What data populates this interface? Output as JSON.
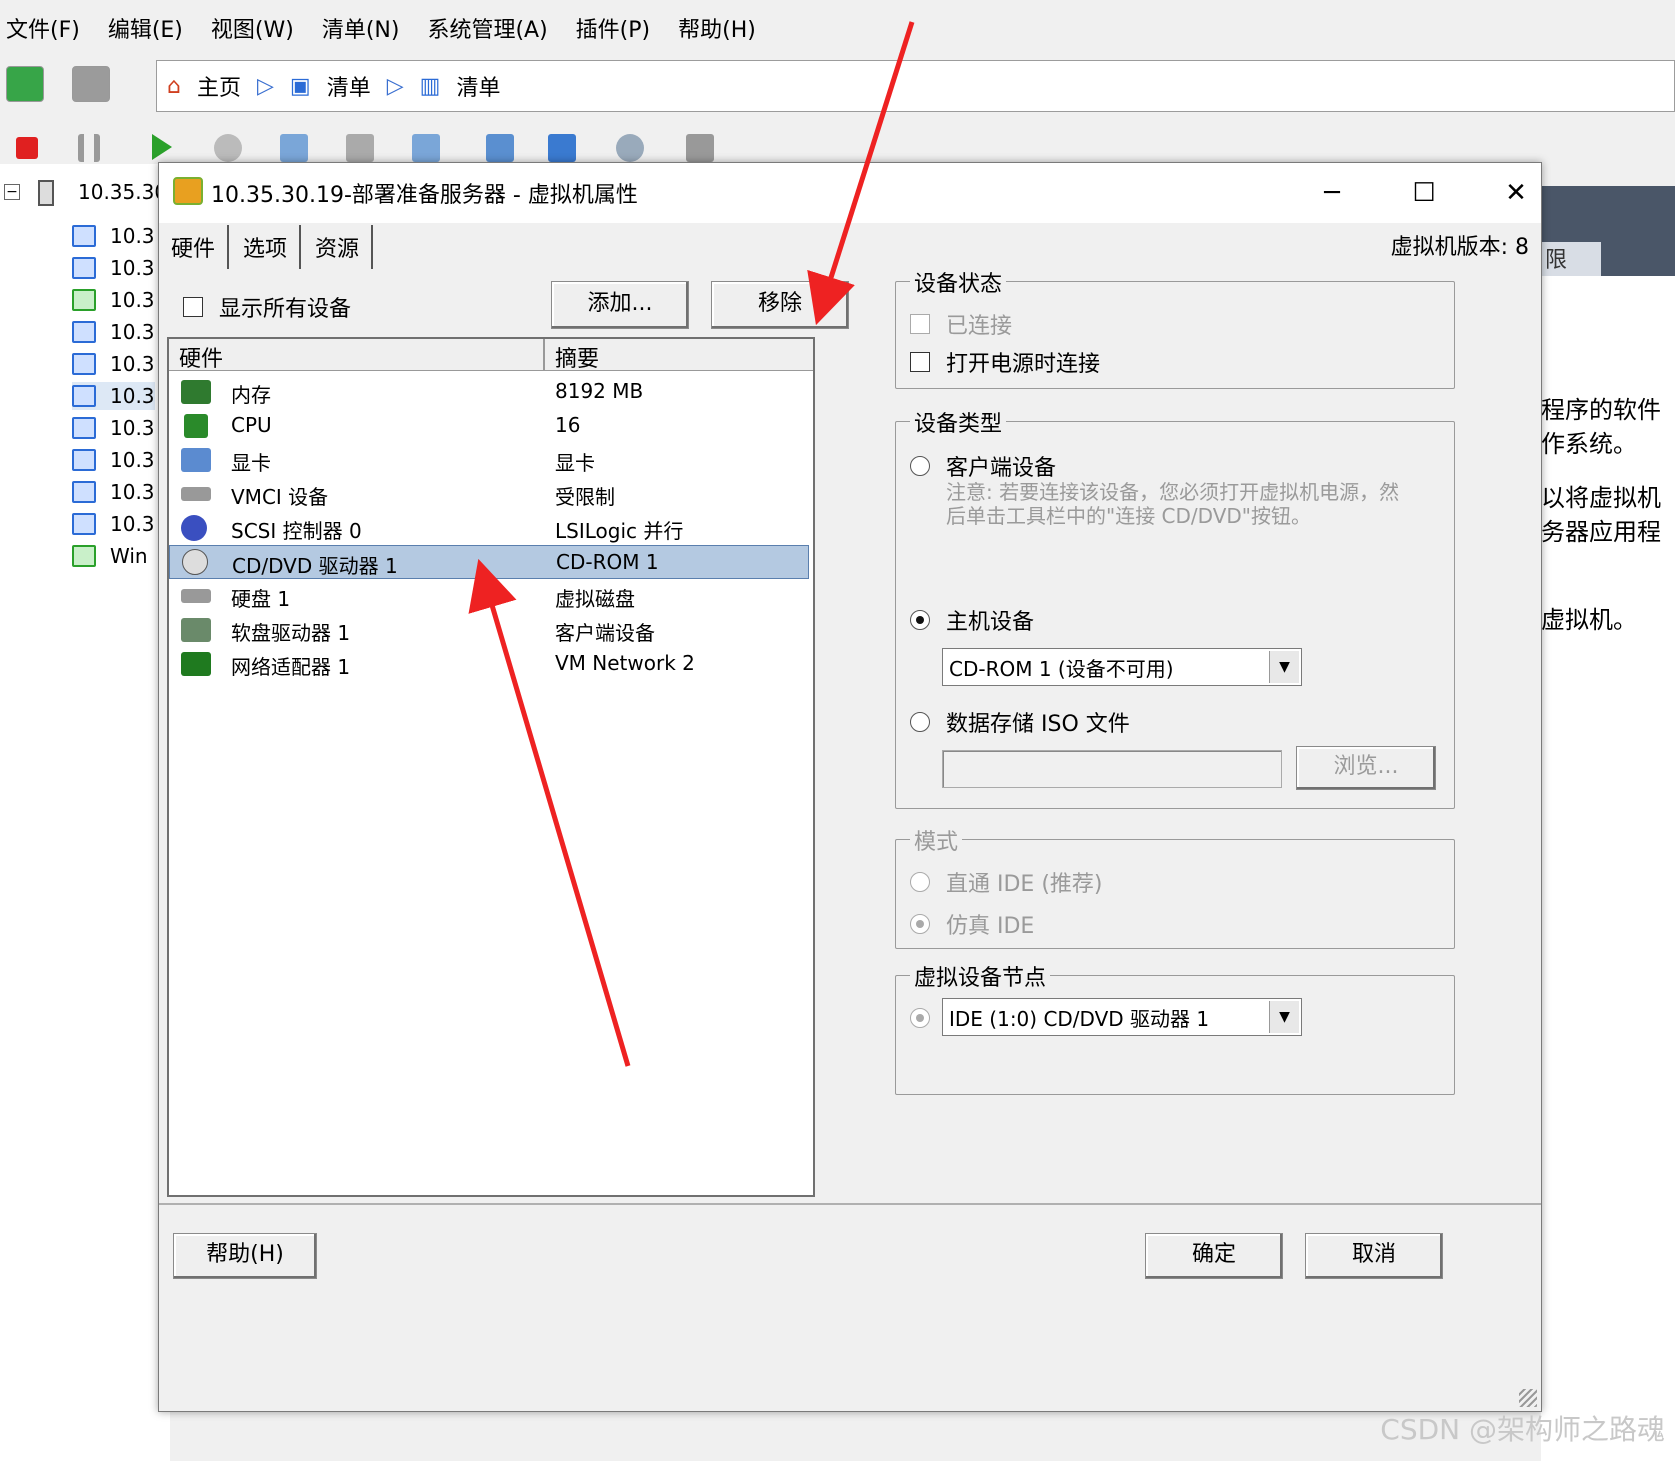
{
  "menu": [
    "文件(F)",
    "编辑(E)",
    "视图(W)",
    "清单(N)",
    "系统管理(A)",
    "插件(P)",
    "帮助(H)"
  ],
  "breadcrumb": {
    "home": "主页",
    "item1": "清单",
    "item2": "清单"
  },
  "tree": {
    "root": "10.35.30",
    "items": [
      "10.3",
      "10.3",
      "10.3",
      "10.3",
      "10.3",
      "10.3",
      "10.3",
      "10.3",
      "10.3",
      "10.3",
      "Win"
    ]
  },
  "right_pane": {
    "tab": "限",
    "lines": [
      "程序的软件",
      "作系统。",
      "以将虚拟机",
      "务器应用程",
      "虚拟机。"
    ]
  },
  "dialog": {
    "title": "10.35.30.19-部署准备服务器 - 虚拟机属性",
    "vm_version": "虚拟机版本: 8",
    "tabs": [
      "硬件",
      "选项",
      "资源"
    ],
    "show_all_devices": "显示所有设备",
    "add_button": "添加...",
    "remove_button": "移除",
    "hw_header": {
      "col1": "硬件",
      "col2": "摘要"
    },
    "hardware": [
      {
        "name": "内存",
        "summary": "8192 MB",
        "icon": "memory-icon"
      },
      {
        "name": "CPU",
        "summary": "16",
        "icon": "cpu-icon"
      },
      {
        "name": "显卡",
        "summary": "显卡",
        "icon": "display-icon"
      },
      {
        "name": "VMCI 设备",
        "summary": "受限制",
        "icon": "vmci-icon"
      },
      {
        "name": "SCSI 控制器 0",
        "summary": "LSILogic 并行",
        "icon": "scsi-icon"
      },
      {
        "name": "CD/DVD 驱动器 1",
        "summary": "CD-ROM 1",
        "icon": "cdrom-icon"
      },
      {
        "name": "硬盘 1",
        "summary": "虚拟磁盘",
        "icon": "harddisk-icon"
      },
      {
        "name": "软盘驱动器 1",
        "summary": "客户端设备",
        "icon": "floppy-icon"
      },
      {
        "name": "网络适配器 1",
        "summary": "VM Network 2",
        "icon": "network-icon"
      }
    ],
    "device_status": {
      "title": "设备状态",
      "connected": "已连接",
      "connect_power_on": "打开电源时连接"
    },
    "device_type": {
      "title": "设备类型",
      "client_device": "客户端设备",
      "note": "注意: 若要连接该设备，您必须打开虚拟机电源，然后单击工具栏中的\"连接 CD/DVD\"按钮。",
      "host_device": "主机设备",
      "host_select": "CD-ROM 1 (设备不可用)",
      "iso": "数据存储 ISO 文件",
      "browse": "浏览..."
    },
    "mode": {
      "title": "模式",
      "passthrough": "直通 IDE (推荐)",
      "emulate": "仿真 IDE"
    },
    "vnode": {
      "title": "虚拟设备节点",
      "select": "IDE (1:0) CD/DVD 驱动器 1"
    },
    "help_button": "帮助(H)",
    "ok_button": "确定",
    "cancel_button": "取消"
  },
  "watermark": "CSDN @架构师之路魂",
  "colors": {
    "annotation_arrow": "#ee2222",
    "selection": "#b4c9e1"
  }
}
